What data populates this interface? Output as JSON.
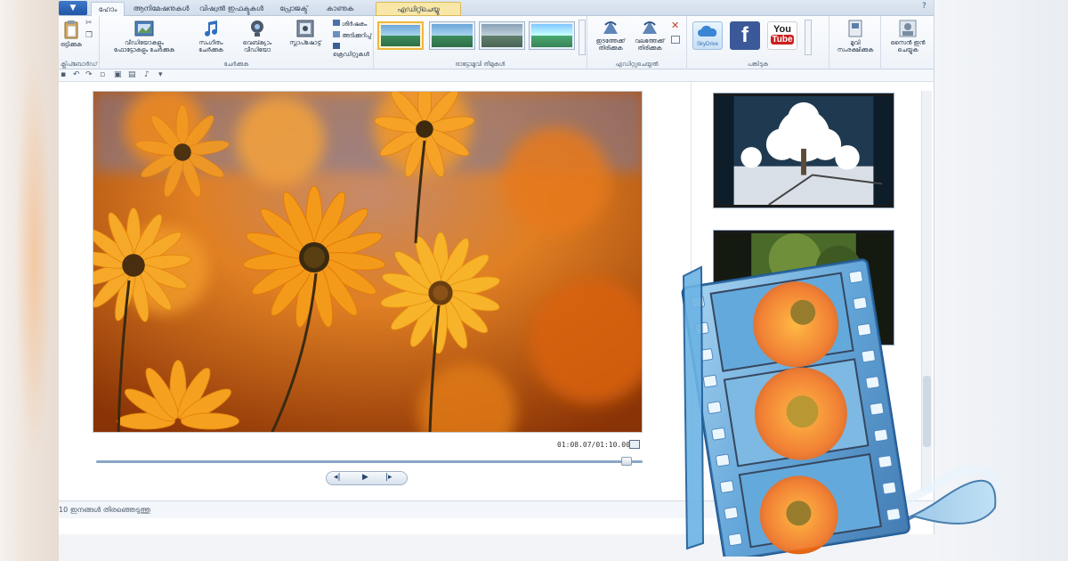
{
  "window": {
    "app_button_label": "▼",
    "tabs": [
      {
        "label": "ഹോം",
        "active": true
      },
      {
        "label": "ആനിമേഷനുകൾ",
        "active": false
      },
      {
        "label": "വിഷ്വൽ ഇഫക്ടുകൾ",
        "active": false
      },
      {
        "label": "പ്രോജക്ട്",
        "active": false
      },
      {
        "label": "കാണുക",
        "active": false
      },
      {
        "label": "എഡിറ്റ്ചെയ്യു",
        "active": false
      }
    ]
  },
  "ribbon": {
    "clipboard": {
      "group_label": "ക്ലിപ്ബോർഡ്",
      "paste_label": "ഒട്ടിക്കുക"
    },
    "add": {
      "group_label": "ചേർക്കുക",
      "add_video_label_1": "വീഡിയോകളും",
      "add_video_label_2": "ഫോട്ടോകളും ചേർക്കുക",
      "add_music_label_1": "സംഗീതം",
      "add_music_label_2": "ചേർക്കുക",
      "webcam_label_1": "വെബ്ക്യാം",
      "webcam_label_2": "വീഡിയോ",
      "snapshot_label": "സ്നാപ്ഷോട്ട്",
      "title_label": "ശീർഷകം",
      "caption_label": "അടിക്കുറിപ്പ്",
      "credits_label": "ക്രെഡിറ്റുകൾ"
    },
    "automovie": {
      "group_label": "ഓട്ടോമൂവി തീമുകൾ"
    },
    "editing": {
      "group_label": "എഡിറ്റുചെയ്യൽ",
      "rotate_left_label_1": "ഇടത്തേക്ക്",
      "rotate_left_label_2": "തിരിക്കുക",
      "rotate_right_label_1": "വലത്തേക്ക്",
      "rotate_right_label_2": "തിരിക്കുക"
    },
    "share": {
      "group_label": "പങ്കിടുക",
      "skydrive": "SkyDrive",
      "facebook": "f",
      "youtube_you": "You",
      "youtube_tube": "Tube"
    },
    "save": {
      "label_1": "മൂവി",
      "label_2": "സംരക്ഷിക്കുക"
    },
    "signin": {
      "label_1": "സൈൻ ഇൻ",
      "label_2": "ചെയ്യുക"
    }
  },
  "preview": {
    "timecode": "01:08.07/01:10.00",
    "progress": 0.97
  },
  "status": {
    "selection_text": "10 ഇനങ്ങൾ തിരഞ്ഞെടുത്തു"
  },
  "colors": {
    "accent": "#1f56a8",
    "ribbon_bg": "#eef3f9",
    "selected_style": "#f0b640"
  }
}
